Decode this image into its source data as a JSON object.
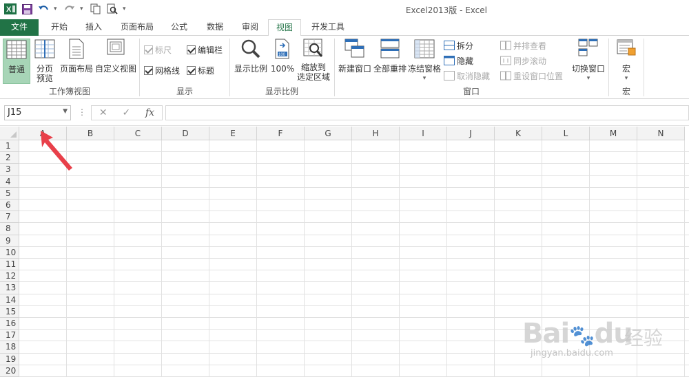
{
  "window": {
    "title": "Excel2013版 - Excel"
  },
  "qat": {
    "icons": [
      "excel-logo-icon",
      "save-icon",
      "undo-icon",
      "redo-icon",
      "copy-icon",
      "print-preview-icon",
      "customize-icon"
    ]
  },
  "tabs": [
    {
      "label": "文件"
    },
    {
      "label": "开始"
    },
    {
      "label": "插入"
    },
    {
      "label": "页面布局"
    },
    {
      "label": "公式"
    },
    {
      "label": "数据"
    },
    {
      "label": "审阅"
    },
    {
      "label": "视图"
    },
    {
      "label": "开发工具"
    }
  ],
  "ribbon": {
    "workbook_views": {
      "group_label": "工作簿视图",
      "normal": "普通",
      "page_break_1": "分页",
      "page_break_2": "预览",
      "page_layout": "页面布局",
      "custom_views": "自定义视图"
    },
    "show": {
      "group_label": "显示",
      "ruler": "标尺",
      "formula_bar": "编辑栏",
      "gridlines": "网格线",
      "headings": "标题",
      "ruler_checked": true,
      "formula_bar_checked": true,
      "gridlines_checked": true,
      "headings_checked": true
    },
    "zoom": {
      "group_label": "显示比例",
      "zoom": "显示比例",
      "hundred": "100%",
      "zoom_sel_1": "缩放到",
      "zoom_sel_2": "选定区域"
    },
    "window": {
      "group_label": "窗口",
      "new_window": "新建窗口",
      "arrange_all": "全部重排",
      "freeze_panes": "冻结窗格",
      "split": "拆分",
      "hide": "隐藏",
      "unhide": "取消隐藏",
      "side_by_side": "并排查看",
      "sync_scroll": "同步滚动",
      "reset_pos": "重设窗口位置",
      "switch_windows": "切换窗口"
    },
    "macros": {
      "group_label": "宏",
      "macros": "宏"
    }
  },
  "formula_bar": {
    "name_box": "J15",
    "fx": "fx",
    "cancel": "✕",
    "enter": "✓",
    "value": ""
  },
  "sheet": {
    "columns": [
      "A",
      "B",
      "C",
      "D",
      "E",
      "F",
      "G",
      "H",
      "I",
      "J",
      "K",
      "L",
      "M",
      "N"
    ],
    "rows": [
      "1",
      "2",
      "3",
      "4",
      "5",
      "6",
      "7",
      "8",
      "9",
      "10",
      "11",
      "12",
      "13",
      "14",
      "15",
      "16",
      "17",
      "18",
      "19",
      "20"
    ]
  },
  "watermark": {
    "brand": "Bai",
    "brand2": "du",
    "cn": "经验",
    "url": "jingyan.baidu.com"
  },
  "colors": {
    "accent": "#217346",
    "selected_view": "#a7d5b7",
    "arrow": "#e8404a"
  }
}
